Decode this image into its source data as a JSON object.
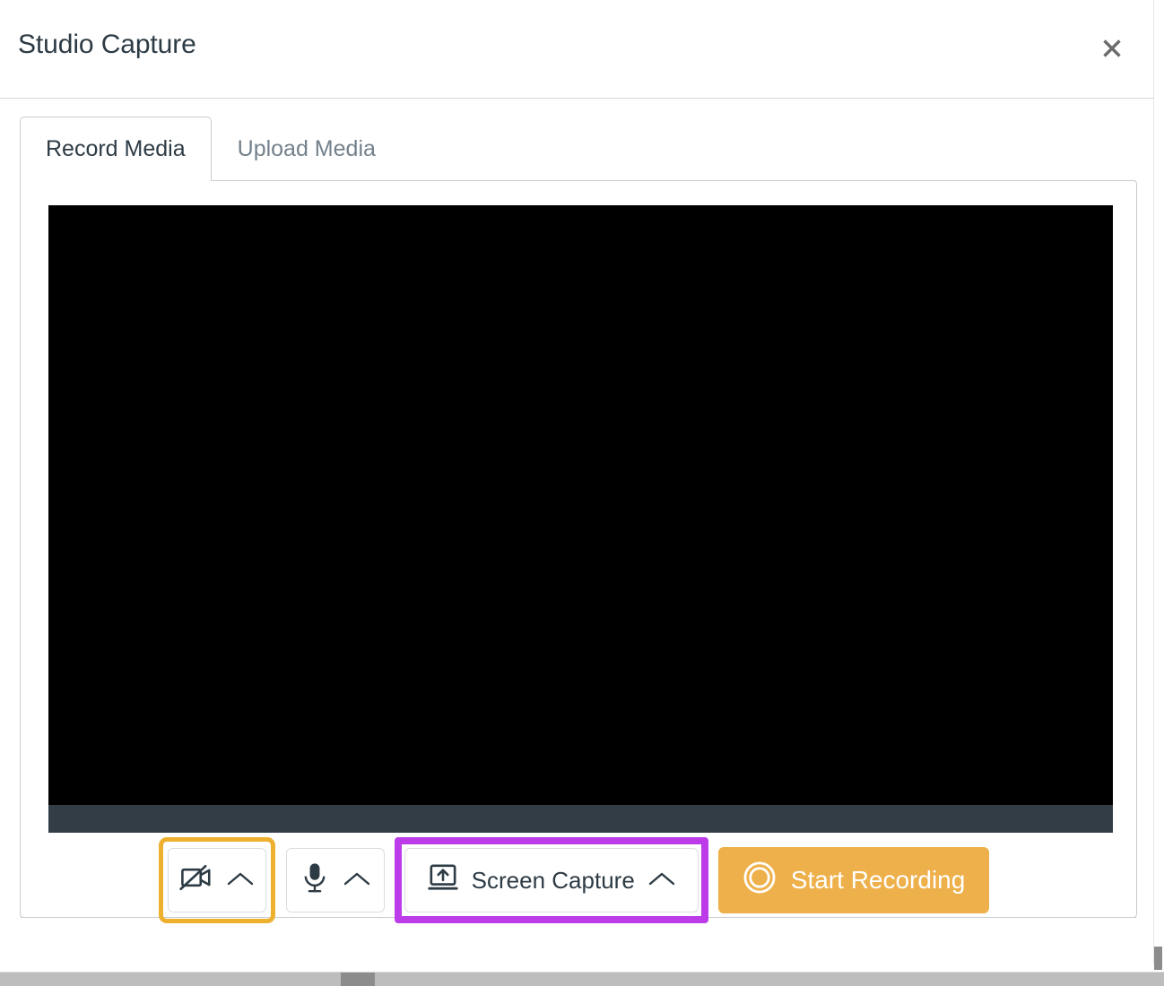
{
  "window": {
    "title": "Studio Capture",
    "close_icon": "close-icon",
    "close_label": "Close"
  },
  "tabs": [
    {
      "label": "Record Media",
      "active": true
    },
    {
      "label": "Upload Media",
      "active": false
    }
  ],
  "preview": {
    "state": "black",
    "background_color": "#000000",
    "control_bar_color": "#333d46"
  },
  "controls": {
    "camera": {
      "icon": "video-camera-off-icon",
      "chevron": "chevron-up-icon",
      "label": "",
      "highlight": "amber",
      "highlight_color": "#eeb02f"
    },
    "microphone": {
      "icon": "microphone-icon",
      "chevron": "chevron-up-icon",
      "label": "",
      "highlight": "none"
    },
    "screen_capture": {
      "icon": "screen-share-icon",
      "chevron": "chevron-up-icon",
      "label": "Screen Capture",
      "highlight": "purple",
      "highlight_color": "#bb3ce8"
    },
    "start_recording": {
      "icon": "record-circle-icon",
      "label": "Start Recording",
      "background_color": "#eeb04a",
      "text_color": "#ffffff"
    }
  },
  "colors": {
    "title_text": "#2d3b45",
    "muted_text": "#73818c",
    "border": "#c7cdd1",
    "amber": "#eeb04a",
    "purple": "#bb3ce8"
  }
}
